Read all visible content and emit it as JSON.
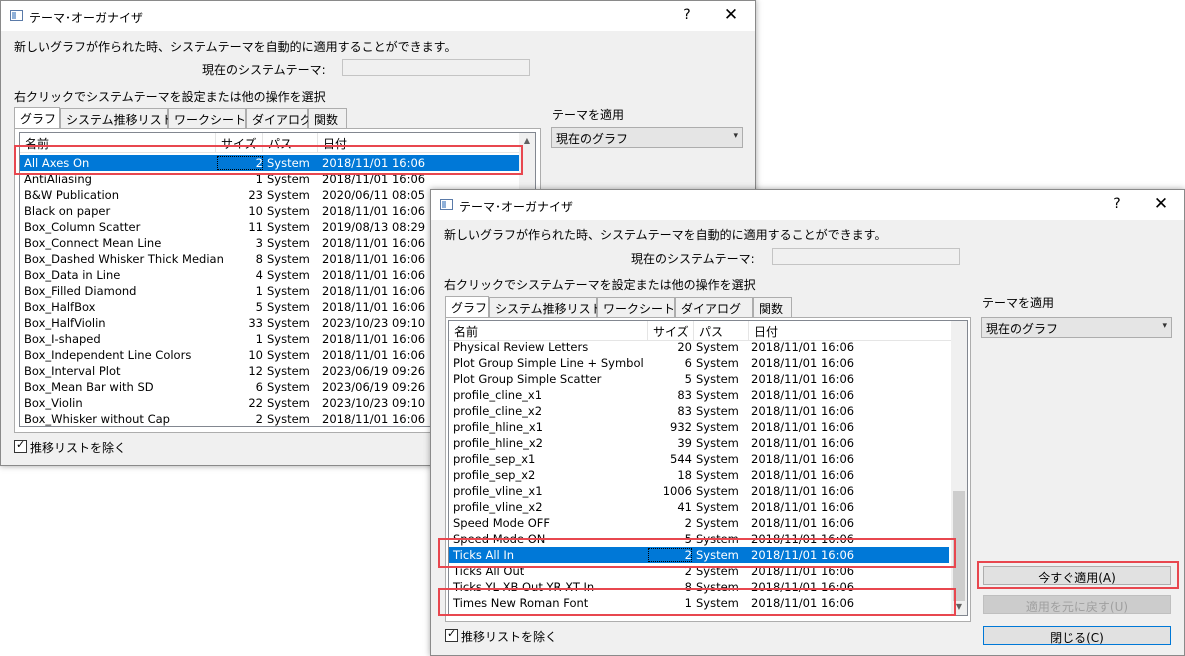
{
  "window": {
    "title": "テーマ･オーガナイザ",
    "help": "?",
    "close": "✕",
    "description": "新しいグラフが作られた時、システムテーマを自動的に適用することができます。",
    "current_theme_label": "現在のシステムテーマ:",
    "current_theme_value": "",
    "instruction": "右クリックでシステムテーマを設定または他の操作を選択",
    "tabs": [
      "グラフ",
      "システム推移リスト",
      "ワークシート",
      "ダイアログ",
      "関数"
    ],
    "columns": [
      "名前",
      "サイズ",
      "パス",
      "日付"
    ],
    "apply_theme_label": "テーマを適用",
    "apply_target": "現在のグラフ",
    "exclude_list_label": "推移リストを除く",
    "exclude_list_checked": true,
    "check_mark": "✓",
    "scroll_up": "▲",
    "scroll_down": "▼",
    "chevron": "▾"
  },
  "back_list": {
    "rows": [
      {
        "name": "All Axes On",
        "size": "2",
        "path": "System",
        "date": "2018/11/01 16:06",
        "selected": true
      },
      {
        "name": "AntiAliasing",
        "size": "1",
        "path": "System",
        "date": "2018/11/01 16:06"
      },
      {
        "name": "B&W Publication",
        "size": "23",
        "path": "System",
        "date": "2020/06/11 08:05"
      },
      {
        "name": "Black on paper",
        "size": "10",
        "path": "System",
        "date": "2018/11/01 16:06"
      },
      {
        "name": "Box_Column Scatter",
        "size": "11",
        "path": "System",
        "date": "2019/08/13 08:29"
      },
      {
        "name": "Box_Connect Mean Line",
        "size": "3",
        "path": "System",
        "date": "2018/11/01 16:06"
      },
      {
        "name": "Box_Dashed Whisker Thick Median",
        "size": "8",
        "path": "System",
        "date": "2018/11/01 16:06"
      },
      {
        "name": "Box_Data in Line",
        "size": "4",
        "path": "System",
        "date": "2018/11/01 16:06"
      },
      {
        "name": "Box_Filled Diamond",
        "size": "1",
        "path": "System",
        "date": "2018/11/01 16:06"
      },
      {
        "name": "Box_HalfBox",
        "size": "5",
        "path": "System",
        "date": "2018/11/01 16:06"
      },
      {
        "name": "Box_HalfViolin",
        "size": "33",
        "path": "System",
        "date": "2023/10/23 09:10"
      },
      {
        "name": "Box_I-shaped",
        "size": "1",
        "path": "System",
        "date": "2018/11/01 16:06"
      },
      {
        "name": "Box_Independent Line Colors",
        "size": "10",
        "path": "System",
        "date": "2018/11/01 16:06"
      },
      {
        "name": "Box_Interval Plot",
        "size": "12",
        "path": "System",
        "date": "2023/06/19 09:26"
      },
      {
        "name": "Box_Mean Bar with SD",
        "size": "6",
        "path": "System",
        "date": "2023/06/19 09:26"
      },
      {
        "name": "Box_Violin",
        "size": "22",
        "path": "System",
        "date": "2023/10/23 09:10"
      },
      {
        "name": "Box_Whisker without Cap",
        "size": "2",
        "path": "System",
        "date": "2018/11/01 16:06"
      }
    ]
  },
  "front_list": {
    "rows": [
      {
        "name": "Physical Review Letters",
        "size": "20",
        "path": "System",
        "date": "2018/11/01 16:06"
      },
      {
        "name": "Plot Group Simple Line + Symbol",
        "size": "6",
        "path": "System",
        "date": "2018/11/01 16:06"
      },
      {
        "name": "Plot Group Simple Scatter",
        "size": "5",
        "path": "System",
        "date": "2018/11/01 16:06"
      },
      {
        "name": "profile_cline_x1",
        "size": "83",
        "path": "System",
        "date": "2018/11/01 16:06"
      },
      {
        "name": "profile_cline_x2",
        "size": "83",
        "path": "System",
        "date": "2018/11/01 16:06"
      },
      {
        "name": "profile_hline_x1",
        "size": "932",
        "path": "System",
        "date": "2018/11/01 16:06"
      },
      {
        "name": "profile_hline_x2",
        "size": "39",
        "path": "System",
        "date": "2018/11/01 16:06"
      },
      {
        "name": "profile_sep_x1",
        "size": "544",
        "path": "System",
        "date": "2018/11/01 16:06"
      },
      {
        "name": "profile_sep_x2",
        "size": "18",
        "path": "System",
        "date": "2018/11/01 16:06"
      },
      {
        "name": "profile_vline_x1",
        "size": "1006",
        "path": "System",
        "date": "2018/11/01 16:06"
      },
      {
        "name": "profile_vline_x2",
        "size": "41",
        "path": "System",
        "date": "2018/11/01 16:06"
      },
      {
        "name": "Speed Mode OFF",
        "size": "2",
        "path": "System",
        "date": "2018/11/01 16:06"
      },
      {
        "name": "Speed Mode ON",
        "size": "5",
        "path": "System",
        "date": "2018/11/01 16:06"
      },
      {
        "name": "Ticks All In",
        "size": "2",
        "path": "System",
        "date": "2018/11/01 16:06",
        "selected": true
      },
      {
        "name": "Ticks All Out",
        "size": "2",
        "path": "System",
        "date": "2018/11/01 16:06"
      },
      {
        "name": "Ticks YL XB Out YR XT In",
        "size": "8",
        "path": "System",
        "date": "2018/11/01 16:06"
      },
      {
        "name": "Times New Roman Font",
        "size": "1",
        "path": "System",
        "date": "2018/11/01 16:06"
      }
    ]
  },
  "buttons": {
    "apply_now": "今すぐ適用(A)",
    "undo_apply": "適用を元に戻す(U)",
    "close": "閉じる(C)"
  },
  "colors": {
    "selection": "#0078d7",
    "highlight_box": "#e8474f"
  }
}
